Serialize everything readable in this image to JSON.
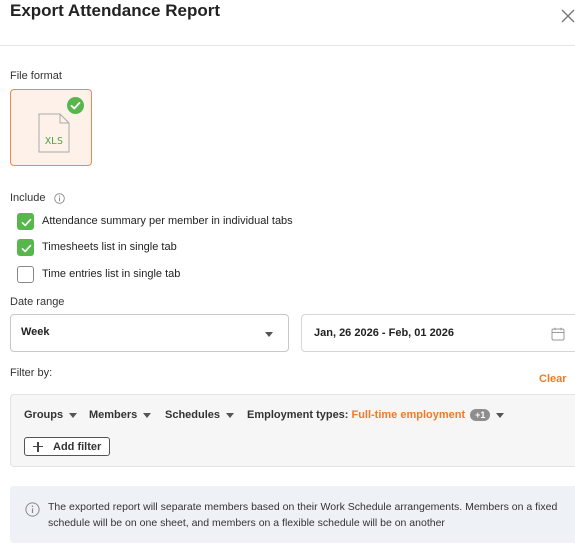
{
  "dialog": {
    "title": "Export Attendance Report"
  },
  "file_format": {
    "label": "File format",
    "selected": "XLS",
    "icon_text": "XLS"
  },
  "include": {
    "label": "Include",
    "options": [
      {
        "label": "Attendance summary per member in individual tabs",
        "checked": true
      },
      {
        "label": "Timesheets list in single tab",
        "checked": true
      },
      {
        "label": "Time entries list in single tab",
        "checked": false
      }
    ]
  },
  "date_range": {
    "label": "Date range",
    "period": "Week",
    "range": "Jan, 26 2026 - Feb, 01 2026"
  },
  "filter": {
    "label": "Filter by:",
    "clear_label": "Clear",
    "chips": {
      "groups": "Groups",
      "members": "Members",
      "schedules": "Schedules",
      "employment_types": "Employment types:",
      "employment_value": "Full-time employment",
      "employment_extra": "+1"
    },
    "add_filter_label": "Add filter"
  },
  "notice": {
    "text": "The exported report will separate members based on their Work Schedule arrangements. Members on a fixed schedule will be on one sheet, and members on a flexible schedule will be on another"
  },
  "colors": {
    "accent": "#ef7b2a",
    "check_green": "#58b74c",
    "card_bg": "#fdf1e9",
    "notice_bg": "#eef2f7"
  },
  "icons": [
    "close-icon",
    "check-icon",
    "xls-file-icon",
    "info-icon",
    "chevron-down-icon",
    "calendar-icon",
    "plus-icon"
  ]
}
